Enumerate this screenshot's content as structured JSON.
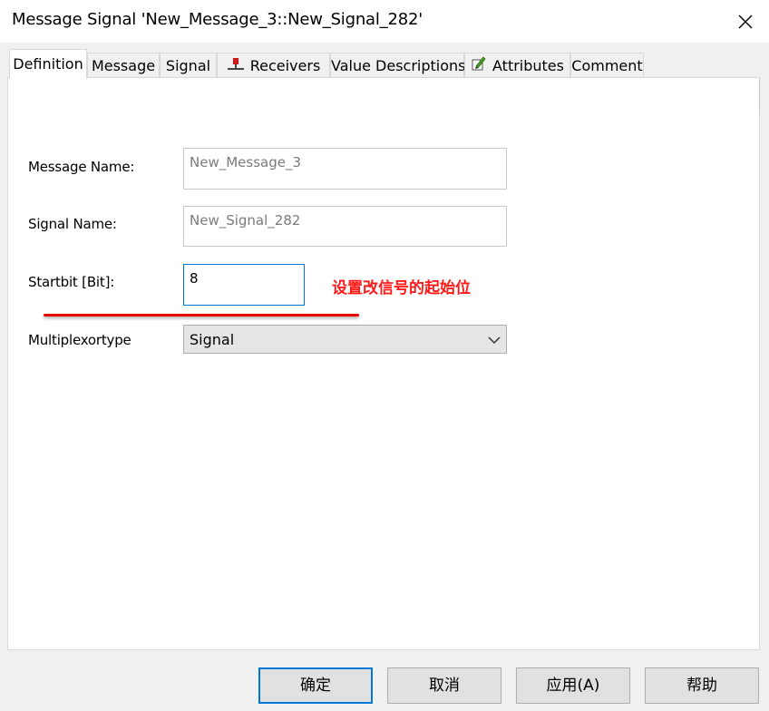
{
  "window": {
    "title": "Message Signal 'New_Message_3::New_Signal_282'"
  },
  "tabs": [
    {
      "label": "Definition"
    },
    {
      "label": "Message"
    },
    {
      "label": "Signal"
    },
    {
      "label": "Receivers",
      "icon": "receiver-icon"
    },
    {
      "label": "Value Descriptions"
    },
    {
      "label": "Attributes",
      "icon": "pencil-icon"
    },
    {
      "label": "Comment"
    }
  ],
  "form": {
    "message_name_label": "Message Name:",
    "message_name_value": "New_Message_3",
    "signal_name_label": "Signal Name:",
    "signal_name_value": "New_Signal_282",
    "startbit_label": "Startbit [Bit]:",
    "startbit_value": "8",
    "multiplexortype_label": "Multiplexortype",
    "multiplexortype_value": "Signal"
  },
  "annotation": {
    "text": "设置改信号的起始位",
    "color": "#ff1a1a"
  },
  "buttons": {
    "ok": "确定",
    "cancel": "取消",
    "apply": "应用(A)",
    "help": "帮助"
  },
  "colors": {
    "accent": "#0078d7",
    "annotation_red": "#e60000"
  }
}
